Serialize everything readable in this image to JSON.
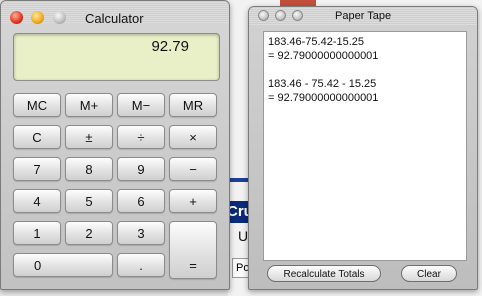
{
  "calculator": {
    "title": "Calculator",
    "display": "92.79",
    "rows": [
      [
        "MC",
        "M+",
        "M−",
        "MR"
      ],
      [
        "C",
        "±",
        "÷",
        "×"
      ],
      [
        "7",
        "8",
        "9",
        "−"
      ],
      [
        "4",
        "5",
        "6",
        "+"
      ],
      [
        "1",
        "2",
        "3",
        "="
      ],
      [
        "0",
        "."
      ]
    ]
  },
  "tape": {
    "title": "Paper Tape",
    "lines": [
      "183.46-75.42-15.25",
      "= 92.79000000000001",
      "",
      "183.46 - 75.42 - 15.25",
      "= 92.79000000000001"
    ],
    "recalculate_label": "Recalculate Totals",
    "clear_label": "Clear"
  },
  "background": {
    "fragment_text": "Cru",
    "fragment_u": "U",
    "fragment_button": "Po"
  }
}
